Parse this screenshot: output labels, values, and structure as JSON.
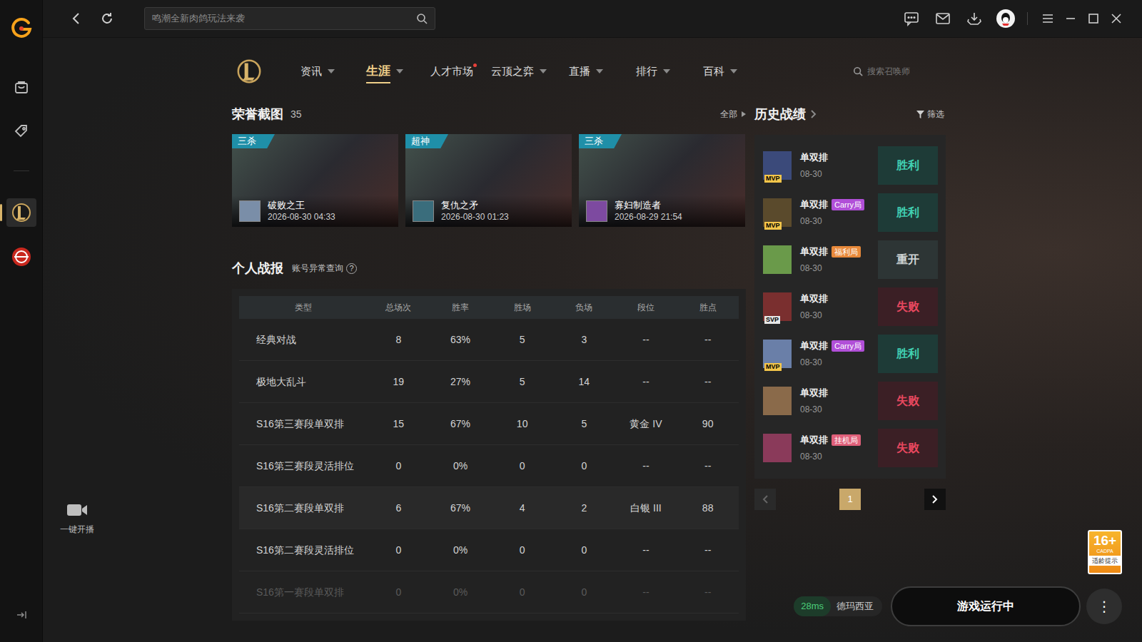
{
  "search": {
    "placeholder": "鸣潮全新肉鸽玩法来袭"
  },
  "sidebar": {
    "items": [
      {
        "selected": false
      },
      {
        "selected": false
      },
      {
        "selected": true
      },
      {
        "selected": false
      }
    ]
  },
  "live": {
    "label": "一键开播"
  },
  "nav": {
    "tabs": [
      {
        "label": "资讯",
        "selected": false,
        "dropdown": true,
        "dot": false
      },
      {
        "label": "生涯",
        "selected": true,
        "dropdown": true,
        "dot": false
      },
      {
        "label": "人才市场",
        "selected": false,
        "dropdown": false,
        "dot": true
      },
      {
        "label": "云顶之弈",
        "selected": false,
        "dropdown": true,
        "dot": false
      },
      {
        "label": "直播",
        "selected": false,
        "dropdown": true,
        "dot": false
      },
      {
        "label": "排行",
        "selected": false,
        "dropdown": true,
        "dot": false
      },
      {
        "label": "百科",
        "selected": false,
        "dropdown": true,
        "dot": false
      }
    ],
    "search": {
      "placeholder": "搜索召唤师"
    }
  },
  "honors": {
    "title": "荣誉截图",
    "count": "35",
    "all": "全部",
    "cards": [
      {
        "badge": "三杀",
        "champion": "破败之王",
        "date": "2026-08-30 04:33"
      },
      {
        "badge": "超神",
        "champion": "复仇之矛",
        "date": "2026-08-30 01:23"
      },
      {
        "badge": "三杀",
        "champion": "寡妇制造者",
        "date": "2026-08-29 21:54"
      }
    ]
  },
  "report": {
    "title": "个人战报",
    "link": "账号异常查询",
    "help": "?",
    "columns": [
      "类型",
      "总场次",
      "胜率",
      "胜场",
      "负场",
      "段位",
      "胜点"
    ],
    "rows": [
      {
        "cells": [
          "经典对战",
          "8",
          "63%",
          "5",
          "3",
          "--",
          "--"
        ],
        "highlighted": false,
        "dimmed": false
      },
      {
        "cells": [
          "极地大乱斗",
          "19",
          "27%",
          "5",
          "14",
          "--",
          "--"
        ],
        "highlighted": false,
        "dimmed": false
      },
      {
        "cells": [
          "S16第三赛段单双排",
          "15",
          "67%",
          "10",
          "5",
          "黄金 IV",
          "90"
        ],
        "highlighted": false,
        "dimmed": false
      },
      {
        "cells": [
          "S16第三赛段灵活排位",
          "0",
          "0%",
          "0",
          "0",
          "--",
          "--"
        ],
        "highlighted": false,
        "dimmed": false
      },
      {
        "cells": [
          "S16第二赛段单双排",
          "6",
          "67%",
          "4",
          "2",
          "白银 III",
          "88"
        ],
        "highlighted": true,
        "dimmed": false
      },
      {
        "cells": [
          "S16第二赛段灵活排位",
          "0",
          "0%",
          "0",
          "0",
          "--",
          "--"
        ],
        "highlighted": false,
        "dimmed": false
      },
      {
        "cells": [
          "S16第一赛段单双排",
          "0",
          "0%",
          "0",
          "0",
          "--",
          "--"
        ],
        "highlighted": false,
        "dimmed": true
      }
    ]
  },
  "history": {
    "title": "历史战绩",
    "filter": "筛选",
    "matches": [
      {
        "mode": "单双排",
        "date": "08-30",
        "badge": "MVP",
        "result": "胜利",
        "kind": "win"
      },
      {
        "mode": "单双排",
        "date": "08-30",
        "badge": "MVP",
        "tag": "Carry局",
        "tag_color": "#b14fd8",
        "result": "胜利",
        "kind": "win"
      },
      {
        "mode": "单双排",
        "date": "08-30",
        "tag": "福利局",
        "tag_color": "#e8893a",
        "result": "重开",
        "kind": "remake"
      },
      {
        "mode": "单双排",
        "date": "08-30",
        "badge": "SVP",
        "result": "失败",
        "kind": "loss"
      },
      {
        "mode": "单双排",
        "date": "08-30",
        "badge": "MVP",
        "tag": "Carry局",
        "tag_color": "#b14fd8",
        "result": "胜利",
        "kind": "win"
      },
      {
        "mode": "单双排",
        "date": "08-30",
        "result": "失败",
        "kind": "loss"
      },
      {
        "mode": "单双排",
        "date": "08-30",
        "tag": "挂机局",
        "tag_color": "#e0607a",
        "result": "失败",
        "kind": "loss"
      }
    ],
    "pagination": {
      "pages": [
        {
          "label": "1",
          "selected": true
        }
      ],
      "prev_disabled": true,
      "next_disabled": false
    }
  },
  "status": {
    "ping": "28ms",
    "server": "德玛西亚",
    "launch": "游戏运行中",
    "more": "⋮"
  },
  "age": {
    "rating": "16+",
    "org": "CADPA",
    "label": "适龄提示"
  }
}
